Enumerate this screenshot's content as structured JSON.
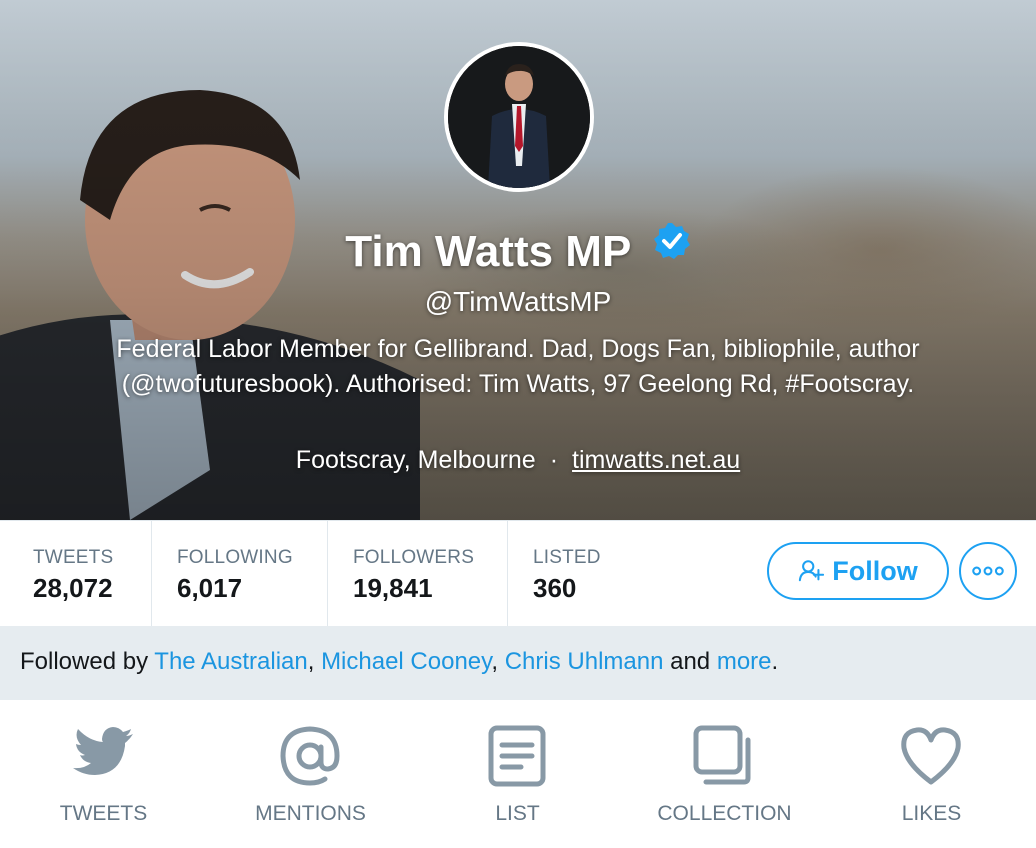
{
  "profile": {
    "name": "Tim Watts MP",
    "handle": "@TimWattsMP",
    "bio": "Federal Labor Member for Gellibrand. Dad, Dogs Fan, bibliophile, author (@twofuturesbook). Authorised: Tim Watts, 97 Geelong Rd, #Footscray.",
    "location": "Footscray, Melbourne",
    "separator": "·",
    "website": "timwatts.net.au"
  },
  "stats": [
    {
      "label": "TWEETS",
      "value": "28,072"
    },
    {
      "label": "FOLLOWING",
      "value": "6,017"
    },
    {
      "label": "FOLLOWERS",
      "value": "19,841"
    },
    {
      "label": "LISTED",
      "value": "360"
    }
  ],
  "actions": {
    "follow_label": "Follow"
  },
  "followed_by": {
    "prefix": "Followed by",
    "users": [
      "The Australian",
      "Michael Cooney",
      "Chris Uhlmann"
    ],
    "sep": ",",
    "and": "and",
    "more": "more",
    "end": "."
  },
  "tabs": [
    {
      "label": "TWEETS",
      "icon": "bird-icon"
    },
    {
      "label": "MENTIONS",
      "icon": "at-icon"
    },
    {
      "label": "LIST",
      "icon": "list-icon"
    },
    {
      "label": "COLLECTION",
      "icon": "collection-icon"
    },
    {
      "label": "LIKES",
      "icon": "heart-icon"
    }
  ],
  "colors": {
    "accent": "#1da1f2",
    "link": "#1b95e0",
    "muted": "#657786",
    "followed_bg": "#e6ecf0",
    "icon_gray": "#8899a6"
  }
}
